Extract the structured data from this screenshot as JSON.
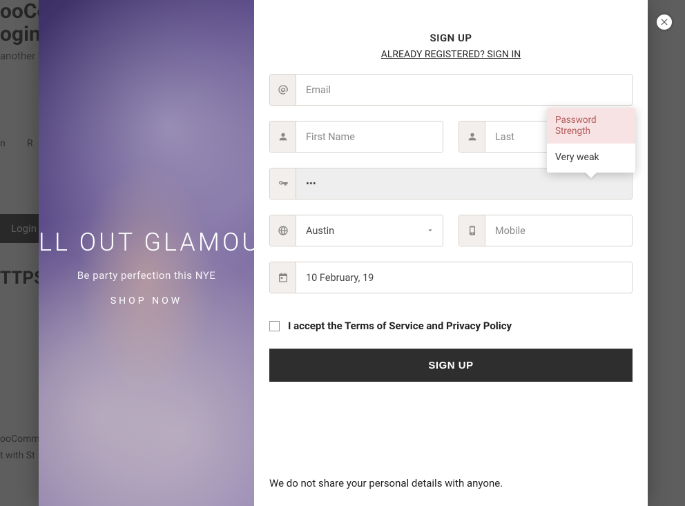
{
  "bg": {
    "title_line1": "ooCommerce",
    "title_line2": "ogin",
    "sub": "another W",
    "nav_item1": "n",
    "nav_item2": "R",
    "tab_login": "Login",
    "https": "TTPS",
    "footer1": "ooCommer",
    "footer2": "t with St"
  },
  "promo": {
    "headline": "LL OUT GLAMOU",
    "sub": "Be party perfection this NYE",
    "cta": "SHOP  NOW"
  },
  "form": {
    "title": "SIGN UP",
    "switch": "ALREADY REGISTERED? SIGN IN",
    "email_ph": "Email",
    "first_ph": "First Name",
    "last_ph": "Last",
    "password_value": "•••",
    "country_value": "Austin",
    "mobile_ph": "Mobile",
    "dob_value": "10 February, 19",
    "tos": "I accept the Terms of Service and Privacy Policy",
    "submit": "SIGN UP",
    "privacy": "We do not share your personal details with anyone."
  },
  "tooltip": {
    "head": "Password Strength",
    "body": "Very weak"
  }
}
